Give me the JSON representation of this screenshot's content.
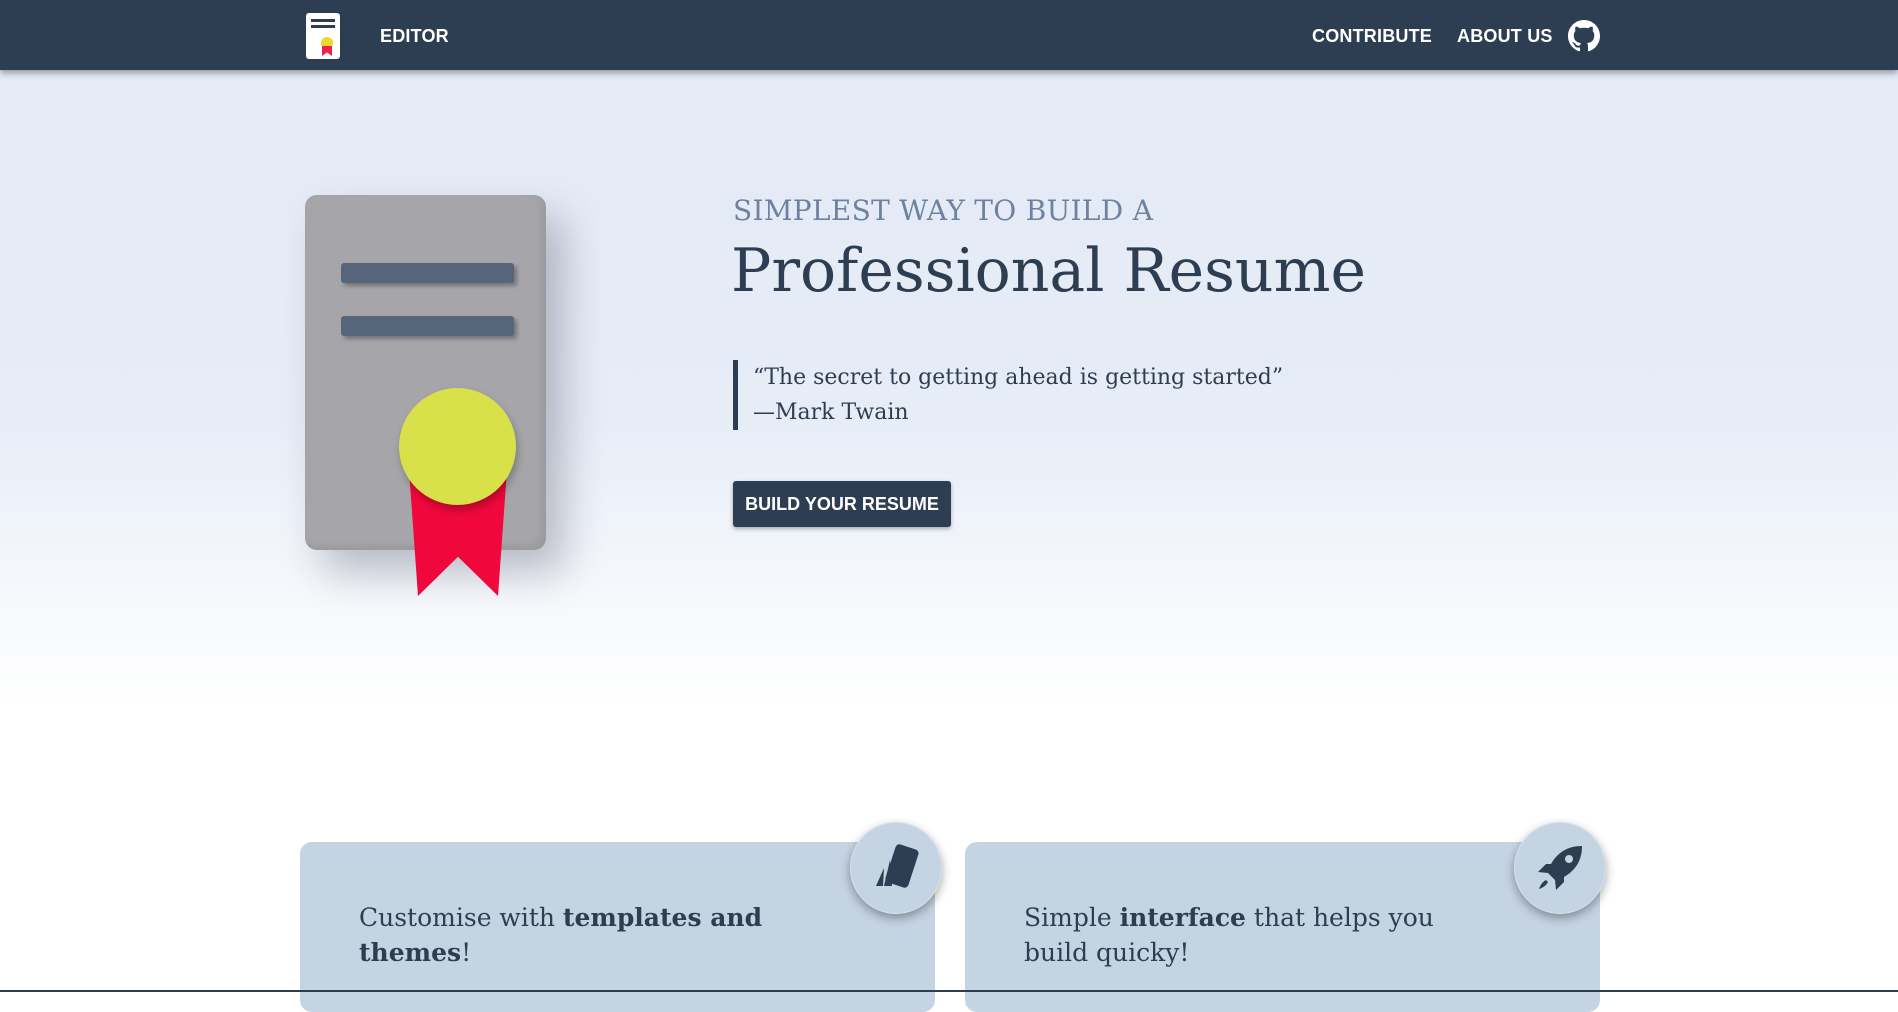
{
  "nav": {
    "logo_icon": "resume-logo-icon",
    "editor_label": "EDITOR",
    "contribute_label": "CONTRIBUTE",
    "about_label": "ABOUT US",
    "github_icon": "github-icon",
    "background": "#2e3e52"
  },
  "hero": {
    "illustration": "certificate-illustration",
    "tagline": "SIMPLEST WAY TO BUILD A",
    "headline": "Professional Resume",
    "quote_text": "“The secret to getting ahead is getting started”",
    "quote_author": "—Mark Twain",
    "cta_label": "BUILD YOUR RESUME",
    "colors": {
      "medal": "#d8e04a",
      "ribbon": "#f0083c",
      "document": "#a6a6aa"
    }
  },
  "features": [
    {
      "icon": "templates-icon",
      "text_before": "Customise with ",
      "text_bold": "templates and themes",
      "text_after": "!"
    },
    {
      "icon": "rocket-icon",
      "text_before": "Simple ",
      "text_bold": "interface",
      "text_after": " that helps you build quicky!"
    }
  ]
}
